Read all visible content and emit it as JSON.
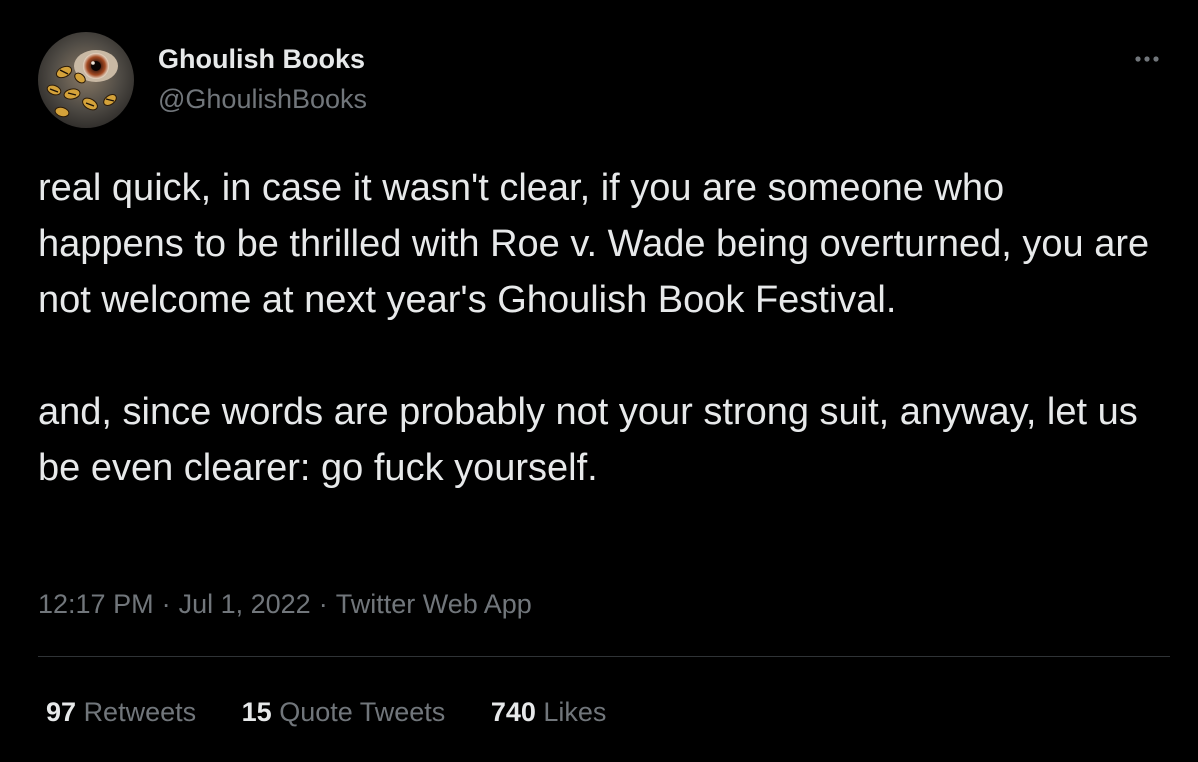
{
  "author": {
    "display_name": "Ghoulish Books",
    "handle": "@GhoulishBooks"
  },
  "tweet": {
    "paragraphs": [
      "real quick, in case it wasn't clear, if you are someone who happens to be thrilled with Roe v. Wade being overturned, you are not welcome at next year's Ghoulish Book Festival.",
      "and, since words are probably not your strong suit, anyway, let us be even clearer: go fuck yourself."
    ]
  },
  "meta": {
    "time": "12:17 PM",
    "separator": "·",
    "date": "Jul 1, 2022",
    "source": "Twitter Web App"
  },
  "stats": {
    "retweets": {
      "count": "97",
      "label": "Retweets"
    },
    "quote_tweets": {
      "count": "15",
      "label": "Quote Tweets"
    },
    "likes": {
      "count": "740",
      "label": "Likes"
    }
  },
  "icons": {
    "more": "more-horizontal-icon",
    "avatar": "avatar-image"
  },
  "colors": {
    "background": "#000000",
    "primary_text": "#e7e9ea",
    "secondary_text": "#71767b",
    "divider": "#2f3336"
  }
}
